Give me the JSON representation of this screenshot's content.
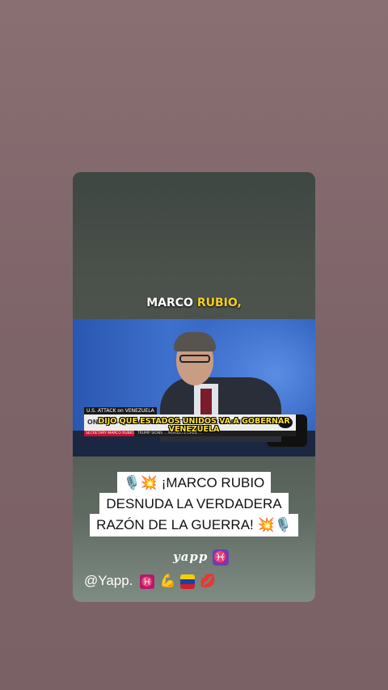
{
  "video": {
    "top_caption_prefix": "MARCO ",
    "top_caption_accent": "RUBIO,",
    "subtitle": "DIJO QUE ESTADOS UNIDOS VA A GOBERNAR VENEZUELA",
    "news_tag": "U.S. ATTACK on VENEZUELA",
    "lower_third": "ONE-ON-ONE WITH SECRETARY MARCO RUBIO",
    "strip_red": "SECRETARY MARCO RUBIO",
    "strip_ticker": "TRUMP SIGNS ... MARKETS OPEN ... ",
    "network_logo": "abc"
  },
  "headline": {
    "line1": "🎙️💥 ¡MARCO RUBIO",
    "line2": "DESNUDA LA VERDADERA",
    "line3": "RAZÓN DE LA GUERRA! 💥🎙️"
  },
  "stickers": {
    "yapp": "yapp",
    "pisces": "♓"
  },
  "handle": {
    "text": "@Yapp.",
    "emoji_pisces": "♓",
    "emoji_arm": "💪",
    "emoji_lips": "💋"
  },
  "colors": {
    "caption_accent": "#f5d020",
    "subtitle_yellow": "#ffe23a",
    "news_red": "#c8102e"
  }
}
